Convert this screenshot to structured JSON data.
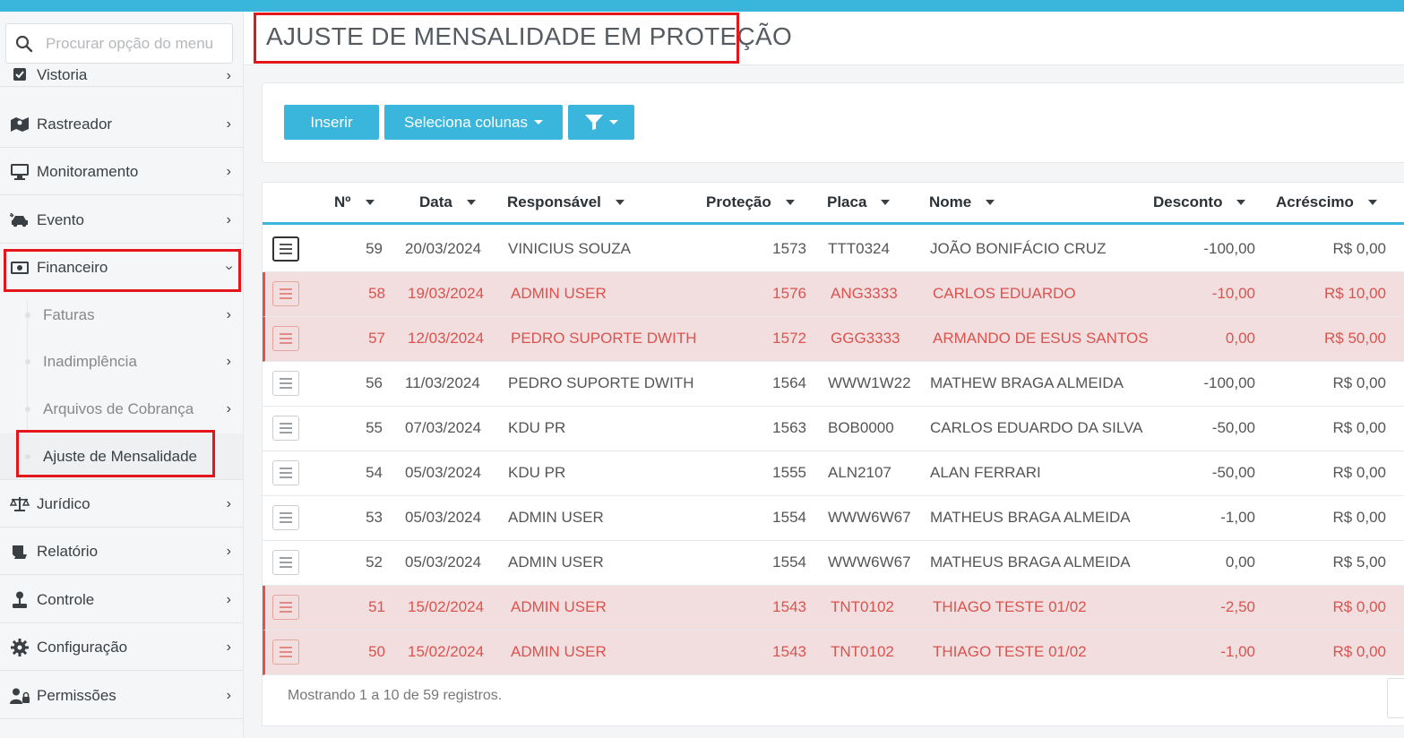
{
  "colors": {
    "accent": "#3ab5dc",
    "highlight_bg": "#f2dede",
    "highlight_text": "#d9534f",
    "annotation": "#e4151b"
  },
  "search": {
    "placeholder": "Procurar opção do menu"
  },
  "sidebar": {
    "items": [
      {
        "label": "Vistoria",
        "icon": "check-square-icon"
      },
      {
        "label": "Rastreador",
        "icon": "map-icon"
      },
      {
        "label": "Monitoramento",
        "icon": "monitor-icon"
      },
      {
        "label": "Evento",
        "icon": "car-crash-icon"
      },
      {
        "label": "Financeiro",
        "icon": "money-icon"
      },
      {
        "label": "Jurídico",
        "icon": "scale-icon"
      },
      {
        "label": "Relatório",
        "icon": "report-icon"
      },
      {
        "label": "Controle",
        "icon": "joystick-icon"
      },
      {
        "label": "Configuração",
        "icon": "gear-icon"
      },
      {
        "label": "Permissões",
        "icon": "user-lock-icon"
      }
    ],
    "submenu": [
      {
        "label": "Faturas"
      },
      {
        "label": "Inadimplência"
      },
      {
        "label": "Arquivos de Cobrança"
      },
      {
        "label": "Ajuste de Mensalidade"
      }
    ]
  },
  "page": {
    "title": "AJUSTE DE MENSALIDADE EM PROTEÇÃO"
  },
  "toolbar": {
    "insert_label": "Inserir",
    "columns_label": "Seleciona colunas"
  },
  "table": {
    "columns": [
      "Nº",
      "Data",
      "Responsável",
      "Proteção",
      "Placa",
      "Nome",
      "Desconto",
      "Acréscimo"
    ],
    "rows": [
      {
        "n": "59",
        "data": "20/03/2024",
        "responsavel": "VINICIUS SOUZA",
        "protecao": "1573",
        "placa": "TTT0324",
        "nome": "JOÃO BONIFÁCIO CRUZ",
        "desconto": "-100,00",
        "acrescimo": "R$ 0,00",
        "highlight": false
      },
      {
        "n": "58",
        "data": "19/03/2024",
        "responsavel": "ADMIN USER",
        "protecao": "1576",
        "placa": "ANG3333",
        "nome": "CARLOS EDUARDO",
        "desconto": "-10,00",
        "acrescimo": "R$ 10,00",
        "highlight": true
      },
      {
        "n": "57",
        "data": "12/03/2024",
        "responsavel": "PEDRO SUPORTE DWITH",
        "protecao": "1572",
        "placa": "GGG3333",
        "nome": "ARMANDO DE ESUS SANTOS",
        "desconto": "0,00",
        "acrescimo": "R$ 50,00",
        "highlight": true
      },
      {
        "n": "56",
        "data": "11/03/2024",
        "responsavel": "PEDRO SUPORTE DWITH",
        "protecao": "1564",
        "placa": "WWW1W22",
        "nome": "MATHEW BRAGA ALMEIDA",
        "desconto": "-100,00",
        "acrescimo": "R$ 0,00",
        "highlight": false
      },
      {
        "n": "55",
        "data": "07/03/2024",
        "responsavel": "KDU PR",
        "protecao": "1563",
        "placa": "BOB0000",
        "nome": "CARLOS EDUARDO DA SILVA",
        "desconto": "-50,00",
        "acrescimo": "R$ 0,00",
        "highlight": false
      },
      {
        "n": "54",
        "data": "05/03/2024",
        "responsavel": "KDU PR",
        "protecao": "1555",
        "placa": "ALN2107",
        "nome": "ALAN FERRARI",
        "desconto": "-50,00",
        "acrescimo": "R$ 0,00",
        "highlight": false
      },
      {
        "n": "53",
        "data": "05/03/2024",
        "responsavel": "ADMIN USER",
        "protecao": "1554",
        "placa": "WWW6W67",
        "nome": "MATHEUS BRAGA ALMEIDA",
        "desconto": "-1,00",
        "acrescimo": "R$ 0,00",
        "highlight": false
      },
      {
        "n": "52",
        "data": "05/03/2024",
        "responsavel": "ADMIN USER",
        "protecao": "1554",
        "placa": "WWW6W67",
        "nome": "MATHEUS BRAGA ALMEIDA",
        "desconto": "0,00",
        "acrescimo": "R$ 5,00",
        "highlight": false
      },
      {
        "n": "51",
        "data": "15/02/2024",
        "responsavel": "ADMIN USER",
        "protecao": "1543",
        "placa": "TNT0102",
        "nome": "THIAGO TESTE 01/02",
        "desconto": "-2,50",
        "acrescimo": "R$ 0,00",
        "highlight": true
      },
      {
        "n": "50",
        "data": "15/02/2024",
        "responsavel": "ADMIN USER",
        "protecao": "1543",
        "placa": "TNT0102",
        "nome": "THIAGO TESTE 01/02",
        "desconto": "-1,00",
        "acrescimo": "R$ 0,00",
        "highlight": true
      }
    ],
    "footer": "Mostrando 1 a 10 de 59 registros."
  }
}
